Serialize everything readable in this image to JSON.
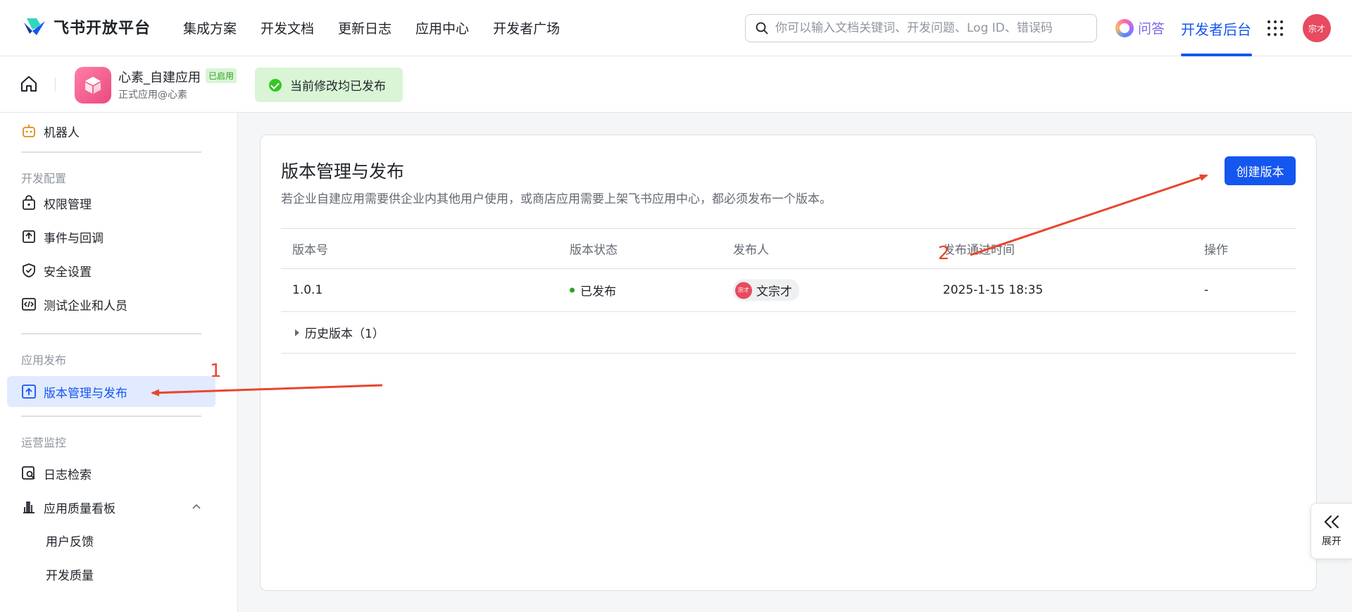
{
  "header": {
    "logo_text": "飞书开放平台",
    "nav": [
      "集成方案",
      "开发文档",
      "更新日志",
      "应用中心",
      "开发者广场"
    ],
    "search_placeholder": "你可以输入文档关键词、开发问题、Log ID、错误码",
    "qa_label": "问答",
    "dev_backend_label": "开发者后台",
    "avatar_text": "宗才"
  },
  "appbar": {
    "app_name": "心素_自建应用",
    "app_badge": "已启用",
    "app_sub": "正式应用@心素",
    "publish_status": "当前修改均已发布"
  },
  "sidebar": {
    "robot": "机器人",
    "section_dev": "开发配置",
    "dev_items": [
      "权限管理",
      "事件与回调",
      "安全设置",
      "测试企业和人员"
    ],
    "section_release": "应用发布",
    "release_item": "版本管理与发布",
    "section_ops": "运营监控",
    "ops_items": [
      "日志检索",
      "应用质量看板"
    ],
    "quality_sub": [
      "用户反馈",
      "开发质量"
    ]
  },
  "main": {
    "title": "版本管理与发布",
    "description": "若企业自建应用需要供企业内其他用户使用，或商店应用需要上架飞书应用中心，都必须发布一个版本。",
    "create_button": "创建版本",
    "table": {
      "columns": [
        "版本号",
        "版本状态",
        "发布人",
        "发布通过时间",
        "操作"
      ],
      "rows": [
        {
          "version": "1.0.1",
          "status": "已发布",
          "publisher": "文宗才",
          "publisher_avatar": "宗才",
          "time": "2025-1-15 18:35",
          "action": "-"
        }
      ],
      "history_label": "历史版本（1）"
    }
  },
  "expand_widget": {
    "label": "展开"
  },
  "annotations": {
    "marker_1": "1",
    "marker_2": "2",
    "color": "#e8462d"
  },
  "colors": {
    "brand": "#1456f0",
    "success": "#2ea121",
    "active_bg": "#e1eaff"
  }
}
